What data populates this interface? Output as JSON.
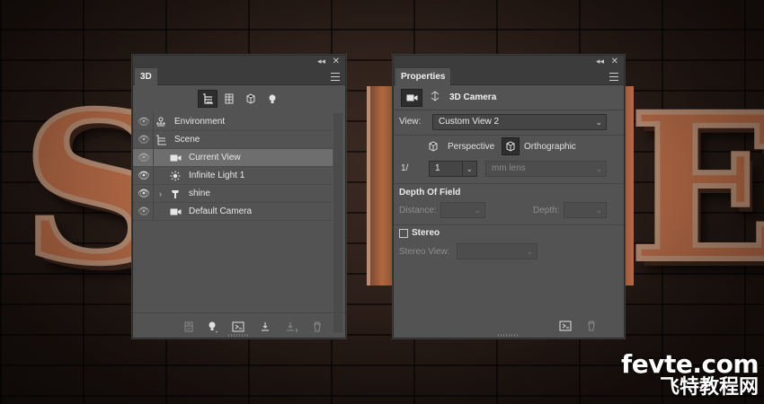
{
  "background": {
    "letters": [
      "S",
      "E"
    ],
    "watermark": {
      "line1": "fevte.com",
      "line2": "飞特教程网"
    },
    "colors": {
      "brick": "#2b1d18",
      "copper": "#b56a46",
      "rim": "#b98e74"
    }
  },
  "panel3d": {
    "tab": "3D",
    "icons": [
      "collapse-icon",
      "close-icon",
      "panel-menu-icon"
    ],
    "filter_icons": [
      "whole-scene-icon",
      "meshes-icon",
      "materials-icon",
      "lights-icon"
    ],
    "layers": [
      {
        "name": "Environment",
        "visible": true,
        "dim_eye": true,
        "indent": 0,
        "icon": "environment-icon"
      },
      {
        "name": "Scene",
        "visible": true,
        "dim_eye": true,
        "indent": 0,
        "icon": "scene-icon"
      },
      {
        "name": "Current View",
        "visible": true,
        "dim_eye": true,
        "indent": 1,
        "icon": "camera-icon",
        "selected": true
      },
      {
        "name": "Infinite Light 1",
        "visible": true,
        "dim_eye": false,
        "indent": 1,
        "icon": "light-icon"
      },
      {
        "name": "shine",
        "visible": true,
        "dim_eye": false,
        "indent": 1,
        "icon": "mesh-icon",
        "expander": "›"
      },
      {
        "name": "Default Camera",
        "visible": true,
        "dim_eye": true,
        "indent": 1,
        "icon": "camera-icon"
      }
    ],
    "footer_icons": [
      "render-icon",
      "add-light-icon",
      "add-constraint-icon",
      "drop-to-ground-icon",
      "move-to-ground-icon",
      "delete-icon"
    ]
  },
  "properties": {
    "tab": "Properties",
    "header_title": "3D Camera",
    "view_label": "View:",
    "view_value": "Custom View 2",
    "perspective_label": "Perspective",
    "orthographic_label": "Orthographic",
    "fov_prefix": "1/",
    "fov_value": "1",
    "lens_value": "mm lens",
    "dof_title": "Depth Of Field",
    "distance_label": "Distance:",
    "depth_label": "Depth:",
    "stereo_label": "Stereo",
    "stereo_view_label": "Stereo View:",
    "footer_icons": [
      "render-icon",
      "delete-icon"
    ]
  }
}
